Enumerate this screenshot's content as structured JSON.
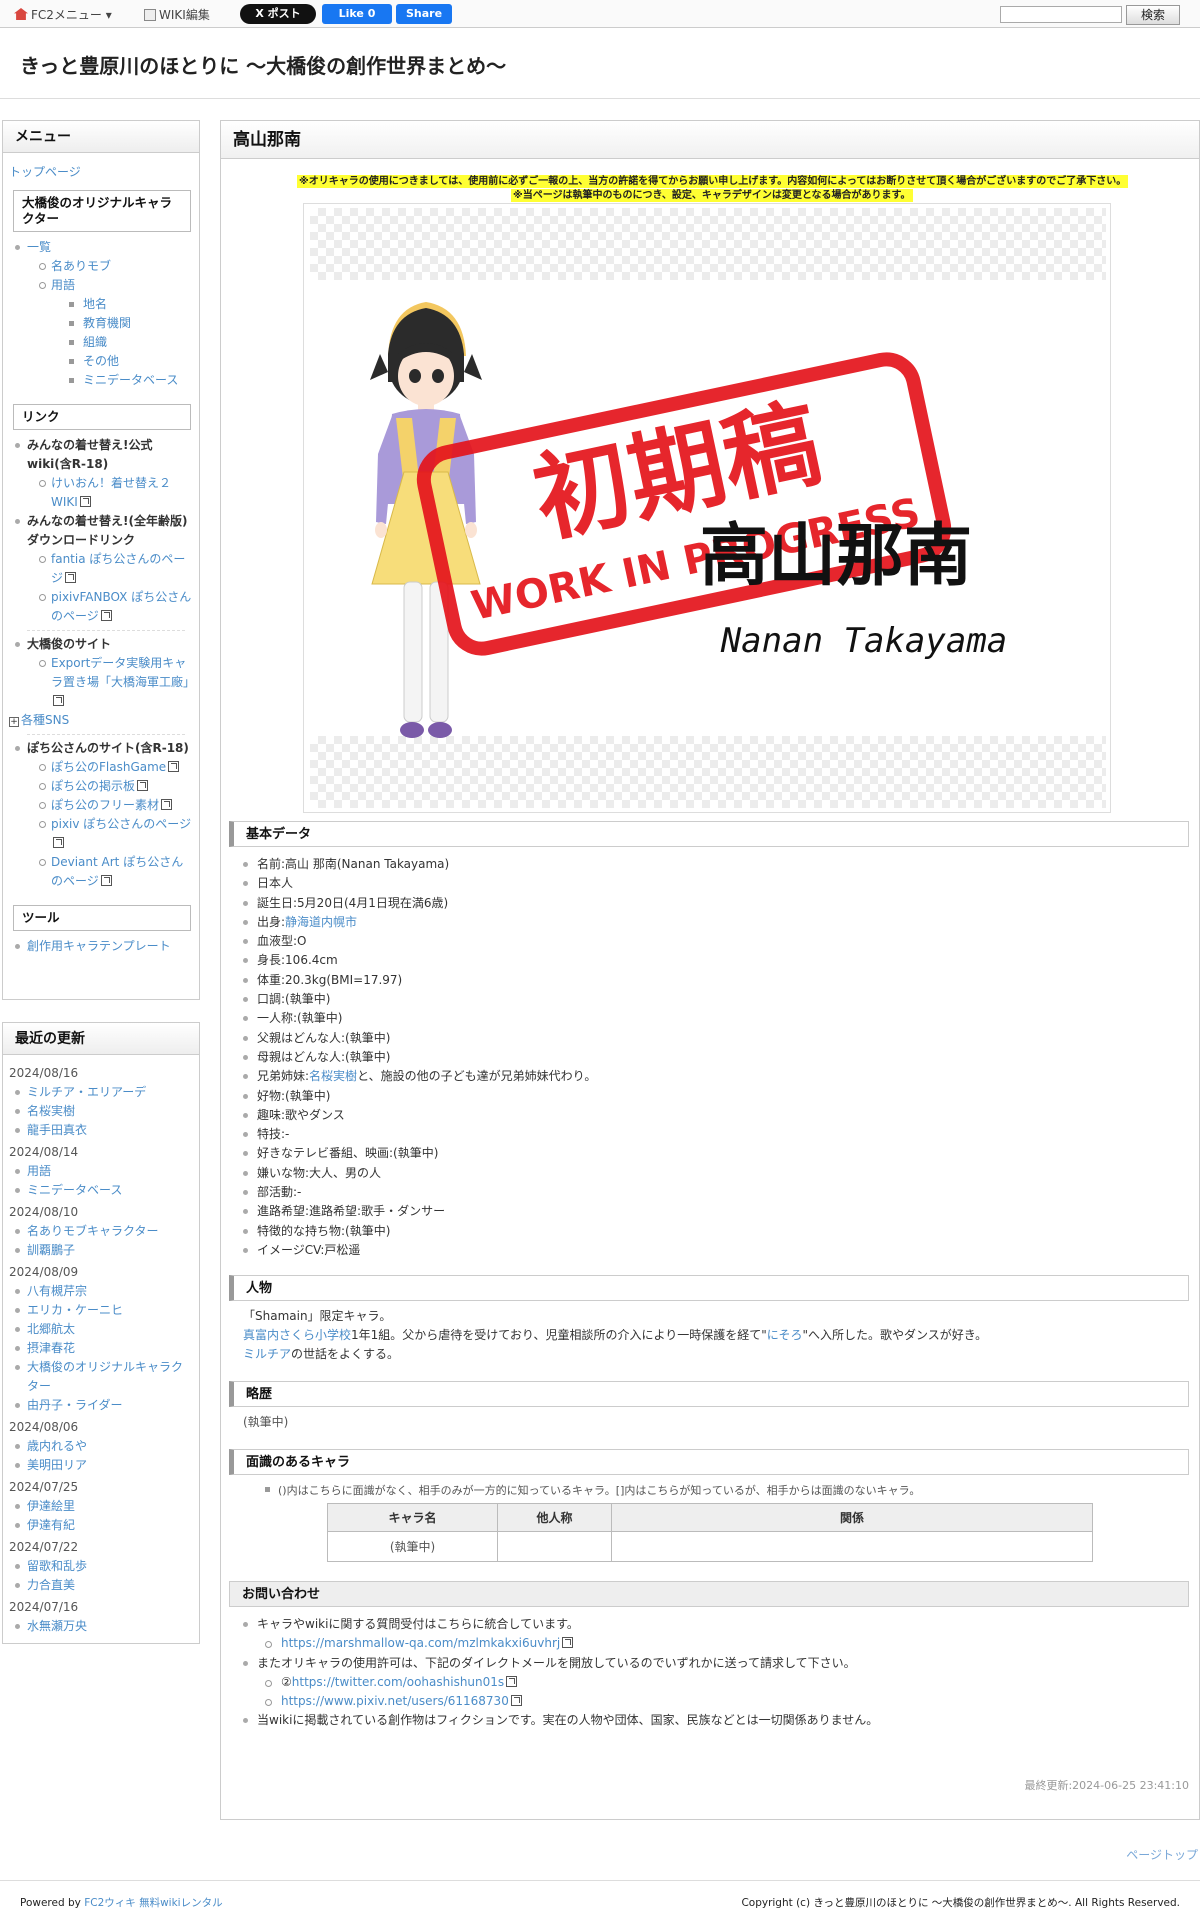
{
  "toolbar": {
    "fc2_menu": "FC2メニュー ▾",
    "wiki_edit": "WIKI編集",
    "x_post": "X ポスト",
    "like": "Like 0",
    "share": "Share",
    "search_button": "検索"
  },
  "site": {
    "title": "きっと豊原川のほとりに 〜大橋俊の創作世界まとめ〜"
  },
  "menu": {
    "title": "メニュー",
    "top_page": "トップページ",
    "chara_heading": "大橋俊のオリジナルキャラクター",
    "chara_items": [
      "一覧",
      "名ありモブ",
      "用語"
    ],
    "term_items": [
      "地名",
      "教育機関",
      "組織",
      "その他",
      "ミニデータベース"
    ],
    "link_heading": "リンク",
    "links": {
      "kisekae": "みんなの着せ替え!公式wiki(含R-18)",
      "keion": "けいおん！着せ替え２WIKI",
      "kisekae_all": "みんなの着せ替え!(全年齢版)ダウンロードリンク",
      "fantia": "fantia ぽち公さんのページ",
      "fanbox": "pixivFANBOX ぽち公さんのページ",
      "ohashi_site": "大橋俊のサイト",
      "export": "Exportデータ実験用キャラ置き場「大橋海軍工廠」",
      "sns": "各種SNS",
      "pochi_site": "ぽち公さんのサイト(含R-18)",
      "flash": "ぽち公のFlashGame",
      "bbs": "ぽち公の掲示板",
      "free": "ぽち公のフリー素材",
      "pixiv": "pixiv ぽち公さんのページ",
      "deviant": "Deviant Art ぽち公さんのページ"
    },
    "tool_heading": "ツール",
    "tool_item": "創作用キャラテンプレート"
  },
  "recent": {
    "title": "最近の更新",
    "groups": [
      {
        "date": "2024/08/16",
        "items": [
          "ミルチア・エリアーデ",
          "名桜実樹",
          "龍手田真衣"
        ]
      },
      {
        "date": "2024/08/14",
        "items": [
          "用語",
          "ミニデータベース"
        ]
      },
      {
        "date": "2024/08/10",
        "items": [
          "名ありモブキャラクター",
          "訓覇鵬子"
        ]
      },
      {
        "date": "2024/08/09",
        "items": [
          "八有槻芹宗",
          "エリカ・ケーニヒ",
          "北郷航太",
          "摂津春花",
          "大橋俊のオリジナルキャラクター",
          "由丹子・ライダー"
        ]
      },
      {
        "date": "2024/08/06",
        "items": [
          "歳内れるや",
          "美明田リア"
        ]
      },
      {
        "date": "2024/07/25",
        "items": [
          "伊達絵里",
          "伊達有紀"
        ]
      },
      {
        "date": "2024/07/22",
        "items": [
          "留歌和乱歩",
          "力合直美"
        ]
      },
      {
        "date": "2024/07/16",
        "items": [
          "水無瀬万央"
        ]
      }
    ]
  },
  "page": {
    "title": "高山那南",
    "notice1": "※オリキャラの使用につきましては、使用前に必ずご一報の上、当方の許諾を得てからお願い申し上げます。内容如何によってはお断りさせて頂く場合がございますのでご了承下さい。",
    "notice2": "※当ページは執筆中のものにつき、設定、キャラデザインは変更となる場合があります。",
    "stamp_main": "初期稿",
    "stamp_sub": "WORK IN PROGRESS",
    "name_kanji": "高山那南",
    "name_roman": "Nanan Takayama"
  },
  "basic": {
    "heading": "基本データ",
    "items": [
      "名前:高山 那南(Nanan Takayama)",
      "日本人",
      "誕生日:5月20日(4月1日現在満6歳)",
      "出身:",
      "血液型:O",
      "身長:106.4cm",
      "体重:20.3kg(BMI=17.97)",
      "口調:(執筆中)",
      "一人称:(執筆中)",
      "父親はどんな人:(執筆中)",
      "母親はどんな人:(執筆中)",
      "兄弟姉妹:",
      "好物:(執筆中)",
      "趣味:歌やダンス",
      "特技:-",
      "好きなテレビ番組、映画:(執筆中)",
      "嫌いな物:大人、男の人",
      "部活動:-",
      "進路希望:進路希望:歌手・ダンサー",
      "特徴的な持ち物:(執筆中)",
      "イメージCV:戸松遥"
    ],
    "birthplace_link": "静海道内幌市",
    "sibling_link": "名桜実樹",
    "sibling_rest": "と、施設の他の子ども達が兄弟姉妹代わり。"
  },
  "person": {
    "heading": "人物",
    "line1": "「Shamain」限定キャラ。",
    "school_link": "真富内さくら小学校",
    "line2a": "1年1組。父から虐待を受けており、児童相談所の介入により一時保護を経て\"",
    "facility_link": "にそろ",
    "line2b": "\"へ入所した。歌やダンスが好き。",
    "friend_link": "ミルチア",
    "line3": "の世話をよくする。"
  },
  "history": {
    "heading": "略歴",
    "text": "(執筆中)"
  },
  "acquaint": {
    "heading": "面識のあるキャラ",
    "note": "()内はこちらに面識がなく、相手のみが一方的に知っているキャラ。[]内はこちらが知っているが、相手からは面識のないキャラ。",
    "columns": [
      "キャラ名",
      "他人称",
      "関係"
    ],
    "row": [
      "(執筆中)",
      "",
      ""
    ]
  },
  "contact": {
    "heading": "お問い合わせ",
    "item1": "キャラやwikiに関する質問受付はこちらに統合しています。",
    "link1": "https://marshmallow-qa.com/mzlmkakxi6uvhrj",
    "item2": "またオリキャラの使用許可は、下記のダイレクトメールを開放しているのでいずれかに送って請求して下さい。",
    "link2_prefix": "②",
    "link2": "https://twitter.com/oohashishun01s",
    "link3": "https://www.pixiv.net/users/61168730",
    "item3": "当wikiに掲載されている創作物はフィクションです。実在の人物や団体、国家、民族などとは一切関係ありません。"
  },
  "last_update": "最終更新:2024-06-25 23:41:10",
  "footer": {
    "page_top": "ページトップ",
    "powered": "Powered by ",
    "powered_link": "FC2ウィキ 無料wikiレンタル",
    "copyright": "Copyright (c) きっと豊原川のほとりに 〜大橋俊の創作世界まとめ〜. All Rights Reserved."
  },
  "colors": {
    "stamp_red": "#e4141b",
    "link_blue": "#4a8cc8",
    "notice_yellow": "#ffff33"
  }
}
